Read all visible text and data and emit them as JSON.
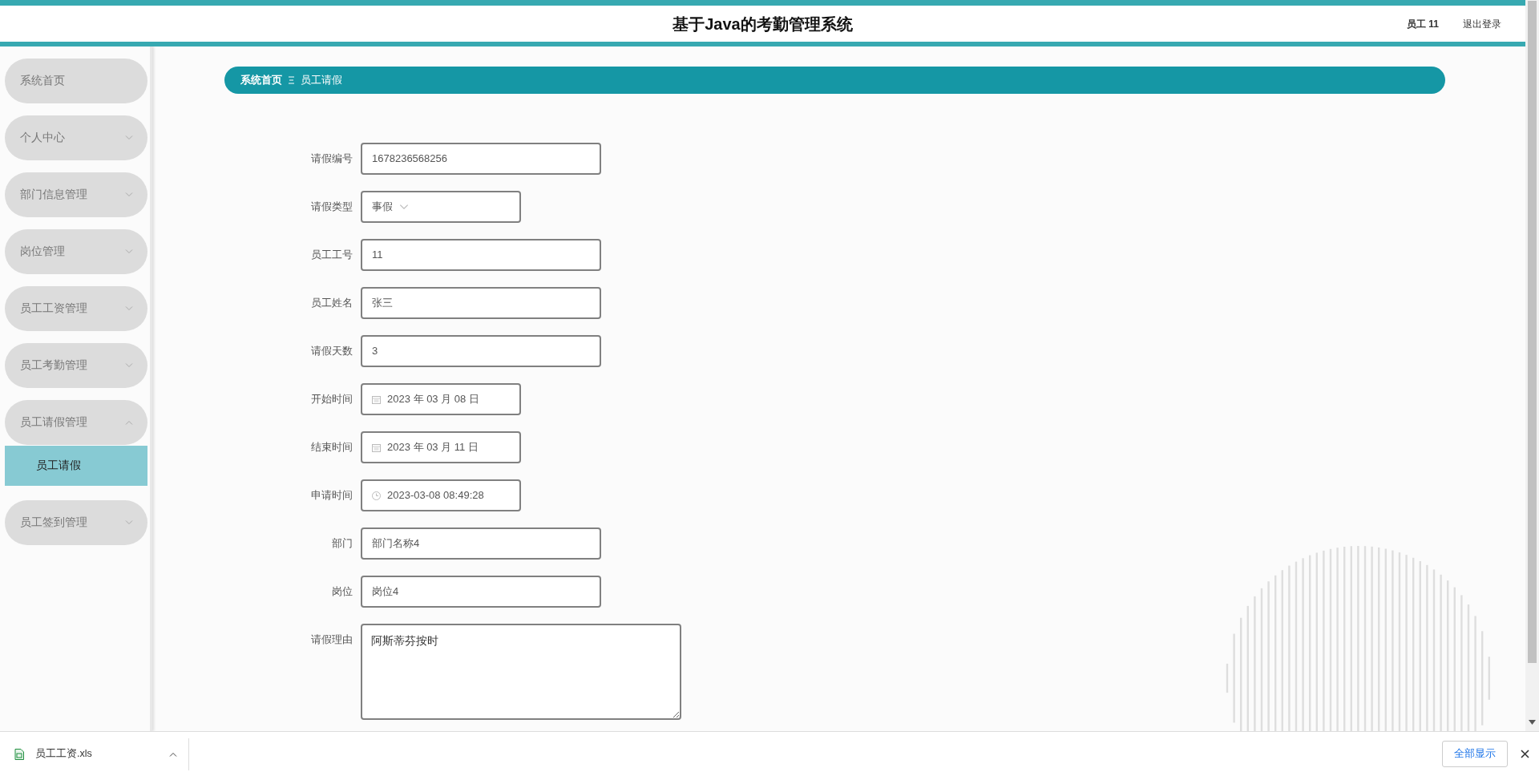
{
  "header": {
    "title": "基于Java的考勤管理系统",
    "user": "员工 11",
    "logout": "退出登录"
  },
  "sidebar": {
    "items": [
      {
        "label": "系统首页",
        "kind": "link",
        "selected": false
      },
      {
        "label": "个人中心",
        "kind": "menu",
        "expanded": false,
        "selected": false
      },
      {
        "label": "部门信息管理",
        "kind": "menu",
        "expanded": false,
        "selected": false
      },
      {
        "label": "岗位管理",
        "kind": "menu",
        "expanded": false,
        "selected": false
      },
      {
        "label": "员工工资管理",
        "kind": "menu",
        "expanded": false,
        "selected": false
      },
      {
        "label": "员工考勤管理",
        "kind": "menu",
        "expanded": false,
        "selected": false
      },
      {
        "label": "员工请假管理",
        "kind": "menu",
        "expanded": true,
        "selected": false,
        "children": [
          {
            "label": "员工请假",
            "selected": true
          }
        ]
      },
      {
        "label": "员工签到管理",
        "kind": "menu",
        "expanded": false,
        "selected": false
      }
    ]
  },
  "breadcrumb": [
    {
      "label": "系统首页"
    },
    {
      "label": "员工请假"
    }
  ],
  "form": {
    "fields": [
      {
        "label": "请假编号",
        "kind": "text",
        "value": "1678236568256"
      },
      {
        "label": "请假类型",
        "kind": "select",
        "value": "事假"
      },
      {
        "label": "员工工号",
        "kind": "text",
        "value": "11"
      },
      {
        "label": "员工姓名",
        "kind": "text",
        "value": "张三"
      },
      {
        "label": "请假天数",
        "kind": "text",
        "value": "3"
      },
      {
        "label": "开始时间",
        "kind": "date",
        "value": "2023 年 03 月 08 日"
      },
      {
        "label": "结束时间",
        "kind": "date",
        "value": "2023 年 03 月 11 日"
      },
      {
        "label": "申请时间",
        "kind": "datetime",
        "value": "2023-03-08 08:49:28"
      },
      {
        "label": "部门",
        "kind": "text",
        "value": "部门名称4"
      },
      {
        "label": "岗位",
        "kind": "text",
        "value": "岗位4"
      },
      {
        "label": "请假理由",
        "kind": "textarea",
        "value": "阿斯蒂芬按时"
      }
    ]
  },
  "downloads": {
    "items": [
      {
        "name": "员工工资.xls"
      }
    ],
    "show_all": "全部显示"
  }
}
